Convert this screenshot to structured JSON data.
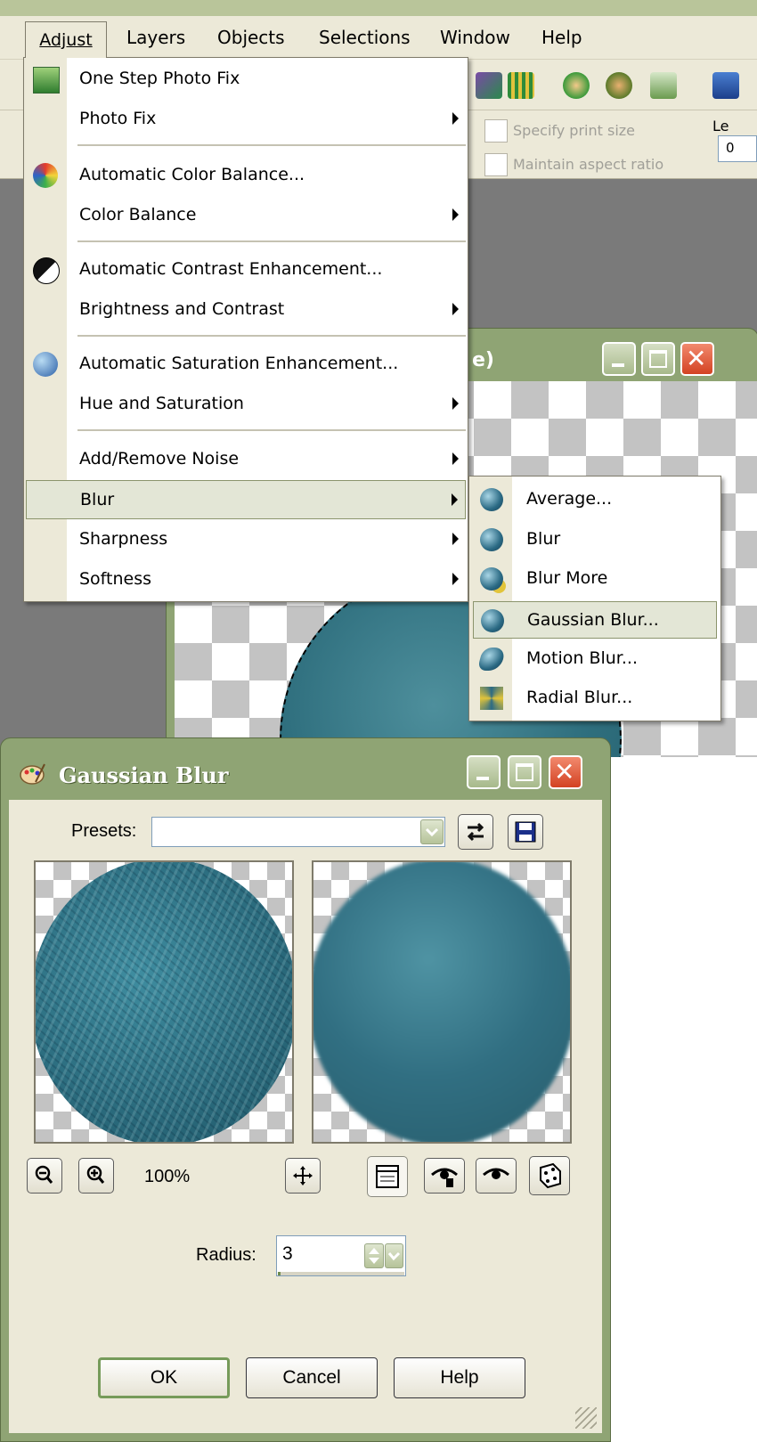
{
  "menubar": {
    "items": [
      {
        "label": "Adjust"
      },
      {
        "label": "Layers"
      },
      {
        "label": "Objects"
      },
      {
        "label": "Selections"
      },
      {
        "label": "Window"
      },
      {
        "label": "Help"
      }
    ]
  },
  "toolbar": {
    "specify_print_size": "Specify print size",
    "maintain_aspect_ratio": "Maintain aspect ratio",
    "left_field_label": "Le",
    "left_field_value": "0"
  },
  "image_window": {
    "title_fragment": "e)"
  },
  "adjust_menu": {
    "items": [
      {
        "label": "One Step Photo Fix",
        "icon": "photo-fix-icon"
      },
      {
        "label": "Photo Fix",
        "submenu": true
      },
      {
        "label": "Automatic Color Balance...",
        "icon": "color-balance-icon"
      },
      {
        "label": "Color Balance",
        "submenu": true
      },
      {
        "label": "Automatic Contrast Enhancement...",
        "icon": "contrast-icon"
      },
      {
        "label": "Brightness and Contrast",
        "submenu": true
      },
      {
        "label": "Automatic Saturation Enhancement...",
        "icon": "saturation-icon"
      },
      {
        "label": "Hue and Saturation",
        "submenu": true
      },
      {
        "label": "Add/Remove Noise",
        "submenu": true
      },
      {
        "label": "Blur",
        "submenu": true,
        "highlighted": true
      },
      {
        "label": "Sharpness",
        "submenu": true
      },
      {
        "label": "Softness",
        "submenu": true
      }
    ]
  },
  "blur_submenu": {
    "items": [
      {
        "label": "Average...",
        "icon": "average-blur-icon"
      },
      {
        "label": "Blur",
        "icon": "blur-icon"
      },
      {
        "label": "Blur More",
        "icon": "blur-more-icon"
      },
      {
        "label": "Gaussian Blur...",
        "icon": "gaussian-blur-icon",
        "highlighted": true
      },
      {
        "label": "Motion Blur...",
        "icon": "motion-blur-icon"
      },
      {
        "label": "Radial Blur...",
        "icon": "radial-blur-icon"
      }
    ]
  },
  "dialog": {
    "title": "Gaussian Blur",
    "presets_label": "Presets:",
    "presets_value": "",
    "zoom_level": "100%",
    "radius_label": "Radius:",
    "radius_value": "3",
    "ok_label": "OK",
    "cancel_label": "Cancel",
    "help_label": "Help"
  },
  "colors": {
    "title_bar": "#8fa474",
    "dialog_face": "#ece9d8",
    "close_button": "#d34222",
    "menu_highlight": "#e3e6d6"
  }
}
